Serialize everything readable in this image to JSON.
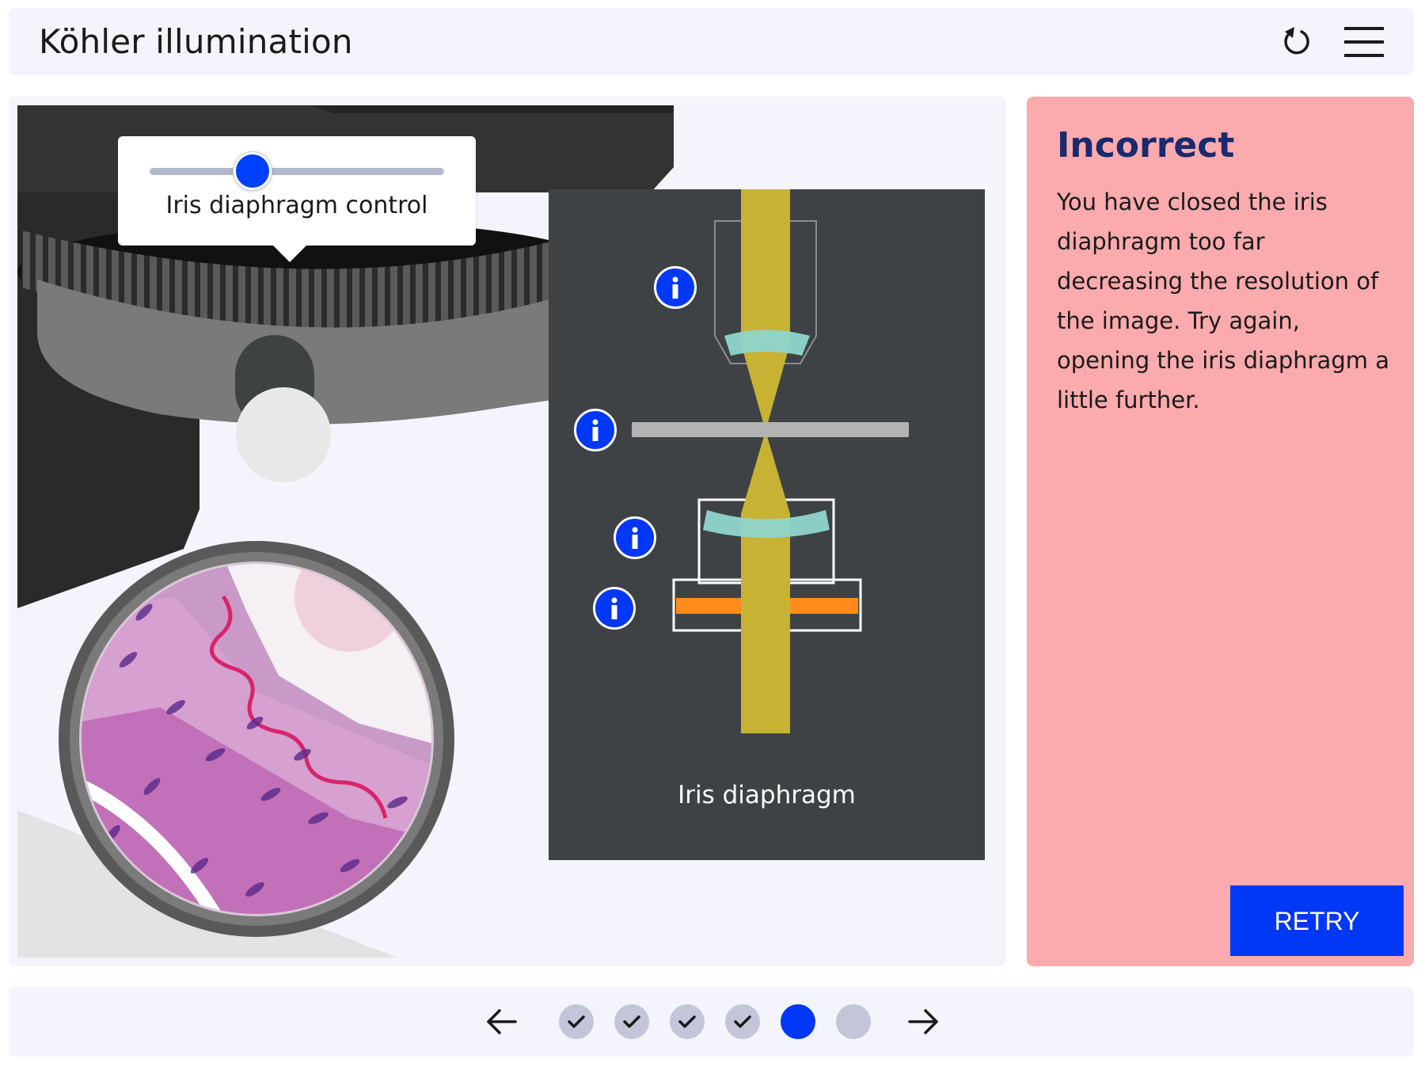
{
  "header": {
    "title": "Köhler illumination",
    "reset_icon": "reset-icon",
    "menu_icon": "hamburger-menu-icon"
  },
  "slider": {
    "label": "Iris diaphragm control",
    "value_fraction": 0.35
  },
  "diagram": {
    "caption": "Iris diaphragm",
    "info_buttons": [
      "info-icon",
      "info-icon",
      "info-icon",
      "info-icon"
    ],
    "colors": {
      "background": "#3f4244",
      "light_beam": "#c8b234",
      "lens": "#8fd6cc",
      "filter": "#ff8c1a",
      "slide": "#b3b3b3"
    }
  },
  "feedback": {
    "title": "Incorrect",
    "message": "You have closed the iris diaphragm too far decreasing the resolution of the image. Try again, opening the iris diaphragm a little further.",
    "retry_label": "RETRY",
    "background": "#fbaaad"
  },
  "progress": {
    "steps": [
      "completed",
      "completed",
      "completed",
      "completed",
      "current",
      "pending"
    ],
    "prev_icon": "arrow-left-icon",
    "next_icon": "arrow-right-icon"
  },
  "colors": {
    "accent": "#0038f5",
    "panel": "#f4f5fc"
  }
}
